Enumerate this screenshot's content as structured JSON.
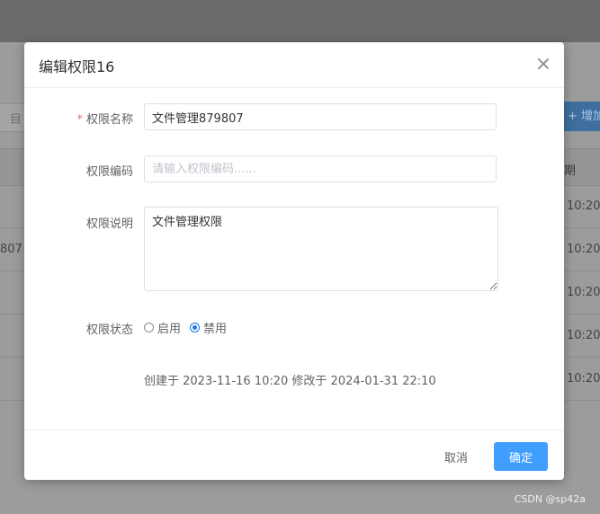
{
  "background": {
    "search_placeholder_fragment": "目",
    "add_button_fragment": "+ 增加",
    "table_header_fragment": "期",
    "row_times": [
      "10:20",
      "10:20",
      "10:20",
      "10:20",
      "10:20"
    ],
    "row_left_fragment": "807"
  },
  "dialog": {
    "title": "编辑权限16",
    "form": {
      "name_label": "权限名称",
      "name_value": "文件管理879807",
      "code_label": "权限编码",
      "code_placeholder": "请输入权限编码......",
      "desc_label": "权限说明",
      "desc_value": "文件管理权限",
      "status_label": "权限状态",
      "status_options": [
        "启用",
        "禁用"
      ],
      "status_selected": "禁用"
    },
    "meta": "创建于 2023-11-16 10:20 修改于 2024-01-31 22:10",
    "footer": {
      "cancel_label": "取消",
      "ok_label": "确定"
    }
  },
  "watermark": "CSDN @sp42a",
  "colors": {
    "primary": "#409eff",
    "required": "#f56c6c"
  }
}
